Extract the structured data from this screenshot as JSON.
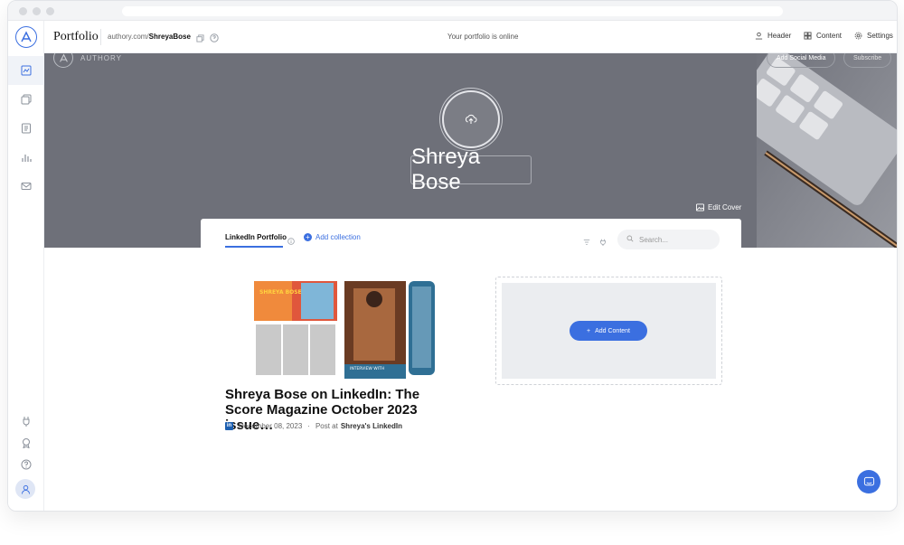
{
  "topbar": {
    "brand": "Portfolio",
    "url_prefix": "authory.com/",
    "url_user": "ShreyaBose",
    "status": "Your portfolio is online",
    "nav": {
      "header": "Header",
      "content": "Content",
      "settings": "Settings"
    }
  },
  "cover": {
    "logo_text": "AUTHORY",
    "add_social": "Add Social Media",
    "subscribe": "Subscribe",
    "name": "Shreya Bose",
    "edit_cover": "Edit Cover"
  },
  "panel": {
    "tab_label": "LinkedIn Portfolio",
    "add_collection": "Add collection",
    "search_placeholder": "Search..."
  },
  "post": {
    "thumb_headline": "SHREYA BOSE",
    "thumb_interview": "INTERVIEW WITH",
    "title": "Shreya Bose on LinkedIn: The Score Magazine October 2023 issue…",
    "date": "December 08, 2023",
    "separator": "·",
    "post_at": "Post at",
    "source": "Shreya's LinkedIn"
  },
  "add_content": {
    "label": "Add Content"
  },
  "colors": {
    "accent": "#3b6fe0",
    "cover_bg": "#6e7079"
  },
  "icons": [
    "logo-icon",
    "portfolio-icon",
    "collections-icon",
    "pages-icon",
    "analytics-icon",
    "newsletter-icon",
    "plugin-icon",
    "badge-icon",
    "help-icon",
    "user-icon",
    "copy-icon",
    "question-icon",
    "upload-icon",
    "image-icon",
    "filter-icon",
    "sort-icon",
    "search-icon",
    "chat-icon"
  ]
}
